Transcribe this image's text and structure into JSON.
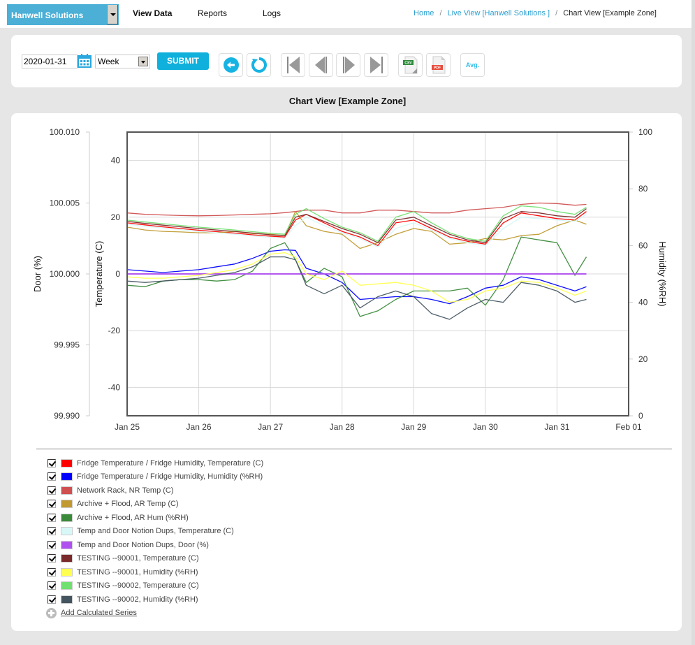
{
  "topbar": {
    "org_select": "Hanwell Solutions",
    "nav": [
      "View Data",
      "Reports",
      "Logs"
    ],
    "active_nav": "View Data",
    "breadcrumb": [
      {
        "label": "Home",
        "link": true
      },
      {
        "label": "Live View [Hanwell Solutions ]",
        "link": true
      },
      {
        "label": "Chart View [Example Zone]",
        "link": false
      }
    ],
    "breadcrumb_sep": "/"
  },
  "toolbar": {
    "date_value": "2020-01-31",
    "period_value": "Week",
    "submit_label": "SUBMIT",
    "csv_label": "CSV",
    "pdf_label": "PDF",
    "avg_label": "Avg.",
    "icons": [
      "back-icon",
      "refresh-icon",
      "first-icon",
      "previous-icon",
      "next-icon",
      "last-icon",
      "csv-export-icon",
      "pdf-export-icon",
      "average-icon"
    ]
  },
  "page_title": "Chart View [Example Zone]",
  "legend": {
    "items": [
      {
        "label": "Fridge Temperature / Fridge Humidity, Temperature (C)",
        "color": "#ff0000",
        "checked": true
      },
      {
        "label": "Fridge Temperature / Fridge Humidity, Humidity (%RH)",
        "color": "#0000ff",
        "checked": true
      },
      {
        "label": "Network Rack, NR Temp (C)",
        "color": "#d05050",
        "checked": true
      },
      {
        "label": "Archive + Flood, AR Temp (C)",
        "color": "#c09a30",
        "checked": true
      },
      {
        "label": "Archive + Flood, AR Hum (%RH)",
        "color": "#3a8a3a",
        "checked": true
      },
      {
        "label": "Temp and Door Notion Dups, Temperature (C)",
        "color": "#d8f8f8",
        "checked": true
      },
      {
        "label": "Temp and Door Notion Dups, Door (%)",
        "color": "#b050f0",
        "checked": true
      },
      {
        "label": "TESTING --90001, Temperature (C)",
        "color": "#7a2a2a",
        "checked": true
      },
      {
        "label": "TESTING --90001, Humidity (%RH)",
        "color": "#ffff50",
        "checked": true
      },
      {
        "label": "TESTING --90002, Temperature (C)",
        "color": "#70e070",
        "checked": true
      },
      {
        "label": "TESTING --90002, Humidity (%RH)",
        "color": "#445560",
        "checked": true
      }
    ],
    "add_label": "Add Calculated Series"
  },
  "chart_data": {
    "type": "line",
    "title": "Chart View [Example Zone]",
    "xlabel": "",
    "x_unit": "days since Jan 25",
    "x_ticks": [
      "Jan 25",
      "Jan 26",
      "Jan 27",
      "Jan 28",
      "Jan 29",
      "Jan 30",
      "Jan 31",
      "Feb 01"
    ],
    "xlim": [
      0,
      7
    ],
    "grid": true,
    "legend_position": "bottom",
    "axes": {
      "door": {
        "label": "Door (%)",
        "ticks": [
          "100.010",
          "100.005",
          "100.000",
          "99.995",
          "99.990"
        ],
        "range": [
          99.99,
          100.01
        ],
        "side": "left-outer"
      },
      "temperature": {
        "label": "Temperature (C)",
        "ticks": [
          "40",
          "20",
          "0",
          "-20",
          "-40"
        ],
        "range": [
          -50,
          50
        ],
        "side": "left"
      },
      "humidity": {
        "label": "Humidity (%RH)",
        "ticks": [
          "100",
          "80",
          "60",
          "40",
          "20",
          "0"
        ],
        "range": [
          0,
          100
        ],
        "side": "right"
      }
    },
    "x": [
      0,
      0.25,
      0.5,
      0.75,
      1.0,
      1.25,
      1.5,
      1.75,
      2.0,
      2.2,
      2.35,
      2.5,
      2.75,
      3.0,
      3.25,
      3.5,
      3.75,
      4.0,
      4.25,
      4.5,
      4.75,
      5.0,
      5.25,
      5.5,
      5.75,
      6.0,
      6.25,
      6.41
    ],
    "series": [
      {
        "name": "Fridge Temperature / Fridge Humidity, Temperature (C)",
        "axis": "temperature",
        "color": "#ff0000",
        "values": [
          18,
          17.3,
          16.6,
          16,
          15.4,
          14.9,
          14.4,
          13.8,
          13.3,
          13,
          19,
          21,
          18,
          15,
          13,
          10,
          18,
          19,
          16,
          13,
          11.5,
          10.5,
          18,
          21.5,
          20.5,
          19.5,
          19,
          22
        ]
      },
      {
        "name": "Fridge Temperature / Fridge Humidity, Humidity (%RH)",
        "axis": "humidity",
        "color": "#0000ff",
        "values": [
          51.5,
          51,
          50.5,
          51,
          51.5,
          52.5,
          53.5,
          55.5,
          58,
          58.5,
          58.3,
          52,
          50,
          47,
          41,
          41.5,
          42,
          42,
          41,
          39.5,
          42,
          45,
          46,
          49,
          48,
          46,
          44,
          45.5
        ]
      },
      {
        "name": "Network Rack, NR Temp (C)",
        "axis": "temperature",
        "color": "#d05050",
        "values": [
          21.5,
          21,
          20.8,
          20.6,
          20.5,
          20.6,
          20.8,
          21,
          21.2,
          21.6,
          22,
          22.5,
          22.5,
          21.5,
          21.5,
          22.5,
          22.5,
          22,
          21.5,
          21.5,
          22.5,
          23,
          23.5,
          24.5,
          25,
          24.8,
          24.2,
          24.5
        ]
      },
      {
        "name": "Archive + Flood, AR Temp (C)",
        "axis": "temperature",
        "color": "#c09a30",
        "values": [
          16.5,
          15.5,
          15,
          14.8,
          14.5,
          14.5,
          15,
          14.2,
          14,
          13.5,
          22,
          17,
          15,
          14,
          9,
          11,
          14,
          16,
          15,
          10.5,
          11,
          12.5,
          12,
          13.5,
          14,
          17,
          19,
          17.5
        ]
      },
      {
        "name": "Archive + Flood, AR Hum (%RH)",
        "axis": "humidity",
        "color": "#3a8a3a",
        "values": [
          46,
          45.5,
          47.5,
          48,
          48,
          47.5,
          48,
          51,
          59,
          61,
          55,
          47,
          52,
          49,
          35,
          37,
          41,
          44,
          44,
          44,
          45,
          39,
          48,
          63,
          62,
          61,
          49.5,
          56
        ]
      },
      {
        "name": "Temp and Door Notion Dups, Temperature (C)",
        "axis": "temperature",
        "color": "#d8f8f8",
        "values": [
          17.5,
          16.8,
          16.2,
          15.6,
          15,
          14.5,
          14,
          13.4,
          12.9,
          12.6,
          17,
          20,
          17,
          14.5,
          12.5,
          9.5,
          16,
          18,
          15.5,
          12.5,
          11,
          10,
          16,
          20,
          19.5,
          19,
          18.5,
          21
        ]
      },
      {
        "name": "Temp and Door Notion Dups, Door (%)",
        "axis": "door",
        "color": "#b050f0",
        "values": [
          100,
          100,
          100,
          100,
          100,
          100,
          100,
          100,
          100,
          100,
          100,
          100,
          100,
          100,
          100,
          100,
          100,
          100,
          100,
          100,
          100,
          100,
          100,
          100,
          100,
          100,
          100,
          100
        ]
      },
      {
        "name": "TESTING --90001, Temperature (C)",
        "axis": "temperature",
        "color": "#7a2a2a",
        "values": [
          18.5,
          17.8,
          17.2,
          16.6,
          16,
          15.5,
          15,
          14.4,
          13.8,
          13.5,
          20,
          21,
          18.5,
          16,
          14,
          11,
          19,
          20,
          17,
          14,
          12,
          11,
          19.5,
          22,
          21.5,
          20.5,
          20,
          23
        ]
      },
      {
        "name": "TESTING --90001, Humidity (%RH)",
        "axis": "humidity",
        "color": "#ffff50",
        "values": [
          49,
          48.5,
          48.5,
          49,
          49.5,
          50.5,
          51.5,
          53.5,
          57,
          57.5,
          56,
          50,
          48,
          51,
          46,
          46.5,
          47,
          46,
          44,
          40,
          41,
          44,
          45,
          47.5,
          47,
          45,
          42.5,
          44
        ]
      },
      {
        "name": "TESTING --90002, Temperature (C)",
        "axis": "temperature",
        "color": "#70e070",
        "values": [
          19,
          18.3,
          17.7,
          17.1,
          16.5,
          16,
          15.5,
          14.9,
          14.3,
          14,
          21,
          23,
          19.5,
          16.5,
          14.5,
          11.5,
          20,
          22,
          18,
          14.5,
          12.5,
          11.5,
          20.5,
          24,
          23.5,
          22,
          21,
          23.5
        ]
      },
      {
        "name": "TESTING --90002, Humidity (%RH)",
        "axis": "humidity",
        "color": "#445560",
        "values": [
          47.5,
          47,
          47.5,
          48,
          48.5,
          49.5,
          50.5,
          52.5,
          56,
          56,
          55,
          46,
          43,
          46,
          38,
          42,
          44,
          42,
          36,
          34,
          38,
          41,
          40,
          47,
          46,
          44,
          40,
          41
        ]
      }
    ]
  }
}
